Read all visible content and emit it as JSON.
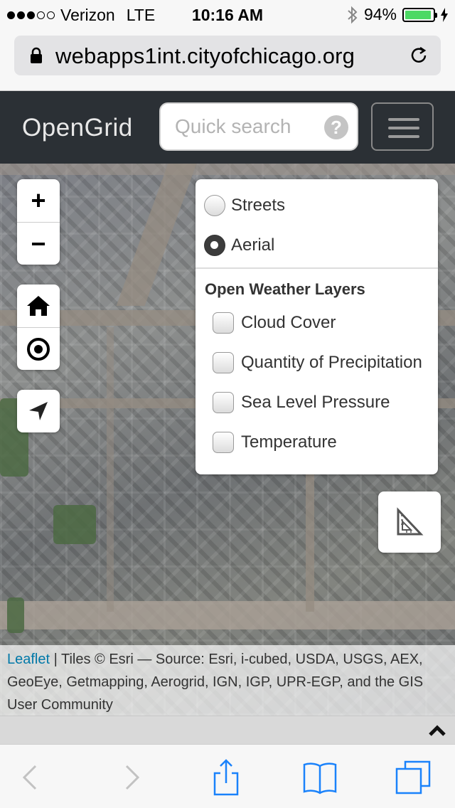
{
  "status_bar": {
    "carrier": "Verizon",
    "network": "LTE",
    "time": "10:16 AM",
    "battery": "94%",
    "battery_level": 0.94,
    "signal_dots_filled": 3,
    "signal_dots_total": 5
  },
  "browser": {
    "url": "webapps1int.cityofchicago.org"
  },
  "navbar": {
    "brand": "OpenGrid",
    "search_placeholder": "Quick search",
    "help_label": "?"
  },
  "map_controls": {
    "zoom_in": "+",
    "zoom_out": "−"
  },
  "layer_panel": {
    "base_layers": [
      {
        "label": "Streets",
        "selected": false
      },
      {
        "label": "Aerial",
        "selected": true
      }
    ],
    "overlay_title": "Open Weather Layers",
    "overlays": [
      {
        "label": "Cloud Cover",
        "checked": false
      },
      {
        "label": "Quantity of Precipitation",
        "checked": false
      },
      {
        "label": "Sea Level Pressure",
        "checked": false
      },
      {
        "label": "Temperature",
        "checked": false
      }
    ]
  },
  "attribution": {
    "link": "Leaflet",
    "text": " | Tiles © Esri — Source: Esri, i-cubed, USDA, USGS, AEX, GeoEye, Getmapping, Aerogrid, IGN, IGP, UPR-EGP, and the GIS User Community"
  },
  "colors": {
    "navbar_bg": "#2b3035",
    "link": "#0078a8",
    "ios_blue": "#1a82fb",
    "battery_green": "#4cd964"
  }
}
